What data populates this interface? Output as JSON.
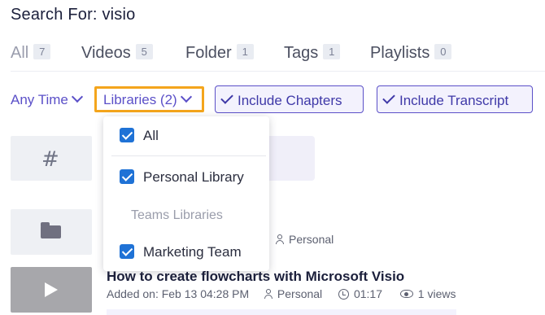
{
  "header": {
    "title": "Search For: visio"
  },
  "tabs": [
    {
      "label": "All",
      "count": "7"
    },
    {
      "label": "Videos",
      "count": "5"
    },
    {
      "label": "Folder",
      "count": "1"
    },
    {
      "label": "Tags",
      "count": "1"
    },
    {
      "label": "Playlists",
      "count": "0"
    }
  ],
  "filters": {
    "time_label": "Any Time",
    "libraries_label": "Libraries (2)",
    "include_chapters_label": "Include Chapters",
    "include_transcript_label": "Include Transcript"
  },
  "dropdown": {
    "all_label": "All",
    "personal_label": "Personal Library",
    "group_label": "Teams Libraries",
    "team_label": "Marketing Team",
    "all_checked": true,
    "personal_checked": true,
    "team_checked": true
  },
  "results": {
    "folder_library": "Personal",
    "video": {
      "title": "How to create flowcharts with Microsoft Visio",
      "added": "Added on: Feb 13 04:28 PM",
      "library": "Personal",
      "duration": "01:17",
      "views": "1 views"
    }
  },
  "colors": {
    "accent": "#5b50c8",
    "highlight_border": "#f4a51c",
    "checkbox": "#1f72d6"
  },
  "icons": [
    "hash-icon",
    "folder-icon",
    "play-icon",
    "person-icon",
    "clock-icon",
    "eye-icon",
    "chevron-down-icon",
    "check-icon"
  ]
}
